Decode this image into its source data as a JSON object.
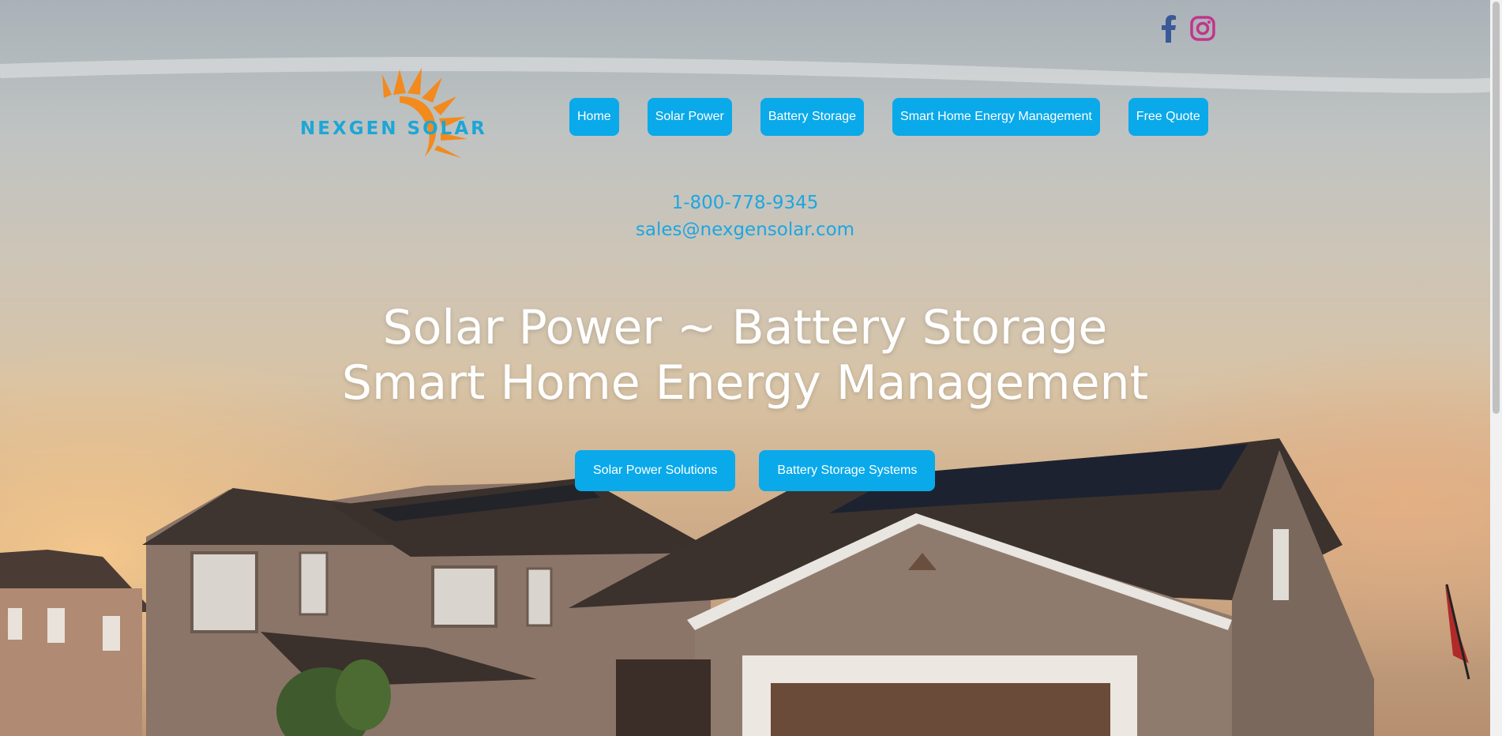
{
  "social": {
    "facebook_icon": "facebook-icon",
    "instagram_icon": "instagram-icon",
    "facebook_color": "#3b5998",
    "instagram_color": "#c1358c"
  },
  "logo": {
    "text": "NEXGEN SOLAR",
    "sun_color": "#f28a1e",
    "text_color": "#1da6d6"
  },
  "nav": {
    "items": [
      {
        "label": "Home"
      },
      {
        "label": "Solar Power"
      },
      {
        "label": "Battery Storage"
      },
      {
        "label": "Smart Home Energy Management"
      },
      {
        "label": "Free Quote"
      }
    ],
    "accent": "#0aa9ea"
  },
  "contact": {
    "phone": "1-800-778-9345",
    "email": "sales@nexgensolar.com"
  },
  "headline": {
    "line1": "Solar Power ~ Battery Storage",
    "line2": "Smart Home Energy Management"
  },
  "cta": {
    "primary": "Solar Power Solutions",
    "secondary": "Battery Storage Systems"
  }
}
